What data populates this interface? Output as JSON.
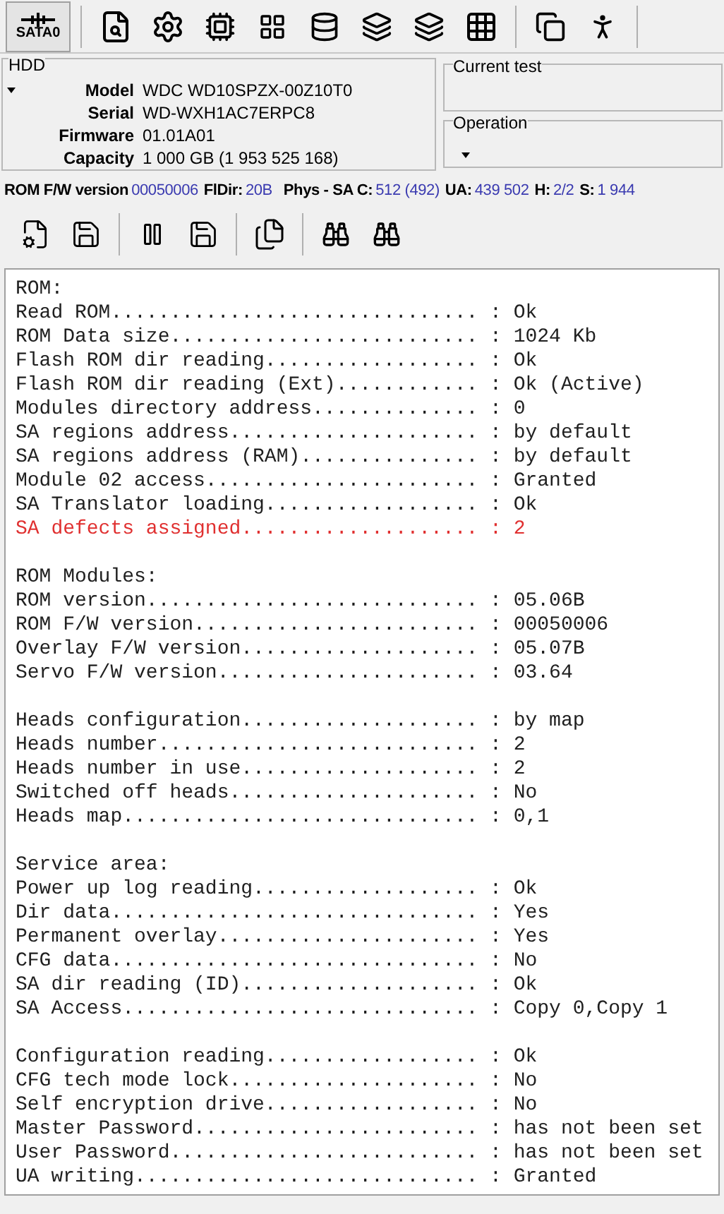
{
  "toolbar": {
    "port_button": {
      "label": "SATA0",
      "selected": true
    }
  },
  "hdd": {
    "title": "HDD",
    "fields": [
      {
        "label": "Model",
        "value": "WDC WD10SPZX-00Z10T0"
      },
      {
        "label": "Serial",
        "value": "WD-WXH1AC7ERPC8"
      },
      {
        "label": "Firmware",
        "value": "01.01A01"
      },
      {
        "label": "Capacity",
        "value": "1 000 GB (1 953 525 168)"
      }
    ]
  },
  "current_test": {
    "title": "Current test"
  },
  "operation": {
    "title": "Operation"
  },
  "info_bar": [
    {
      "label": "ROM F/W version",
      "value": "00050006"
    },
    {
      "label": "FlDir:",
      "value": "20B"
    },
    {
      "label": "Phys - SA C:",
      "value": "512 (492)"
    },
    {
      "label": "UA:",
      "value": "439 502"
    },
    {
      "label": "H:",
      "value": "2/2"
    },
    {
      "label": "S:",
      "value": "1 944"
    }
  ],
  "log": [
    {
      "kind": "line",
      "text": "ROM:",
      "alert": false
    },
    {
      "kind": "line",
      "text": "Read ROM............................... : Ok",
      "alert": false
    },
    {
      "kind": "line",
      "text": "ROM Data size.......................... : 1024 Kb",
      "alert": false
    },
    {
      "kind": "line",
      "text": "Flash ROM dir reading.................. : Ok",
      "alert": false
    },
    {
      "kind": "line",
      "text": "Flash ROM dir reading (Ext)............ : Ok (Active)",
      "alert": false
    },
    {
      "kind": "line",
      "text": "Modules directory address.............. : 0",
      "alert": false
    },
    {
      "kind": "line",
      "text": "SA regions address..................... : by default",
      "alert": false
    },
    {
      "kind": "line",
      "text": "SA regions address (RAM)............... : by default",
      "alert": false
    },
    {
      "kind": "line",
      "text": "Module 02 access....................... : Granted",
      "alert": false
    },
    {
      "kind": "line",
      "text": "SA Translator loading.................. : Ok",
      "alert": false
    },
    {
      "kind": "line",
      "text": "SA defects assigned.................... : 2",
      "alert": true
    },
    {
      "kind": "blank"
    },
    {
      "kind": "line",
      "text": "ROM Modules:",
      "alert": false
    },
    {
      "kind": "line",
      "text": "ROM version............................ : 05.06B",
      "alert": false
    },
    {
      "kind": "line",
      "text": "ROM F/W version........................ : 00050006",
      "alert": false
    },
    {
      "kind": "line",
      "text": "Overlay F/W version.................... : 05.07B",
      "alert": false
    },
    {
      "kind": "line",
      "text": "Servo F/W version...................... : 03.64",
      "alert": false
    },
    {
      "kind": "blank"
    },
    {
      "kind": "line",
      "text": "Heads configuration.................... : by map",
      "alert": false
    },
    {
      "kind": "line",
      "text": "Heads number........................... : 2",
      "alert": false
    },
    {
      "kind": "line",
      "text": "Heads number in use.................... : 2",
      "alert": false
    },
    {
      "kind": "line",
      "text": "Switched off heads..................... : No",
      "alert": false
    },
    {
      "kind": "line",
      "text": "Heads map.............................. : 0,1",
      "alert": false
    },
    {
      "kind": "blank"
    },
    {
      "kind": "line",
      "text": "Service area:",
      "alert": false
    },
    {
      "kind": "line",
      "text": "Power up log reading................... : Ok",
      "alert": false
    },
    {
      "kind": "line",
      "text": "Dir data............................... : Yes",
      "alert": false
    },
    {
      "kind": "line",
      "text": "Permanent overlay...................... : Yes",
      "alert": false
    },
    {
      "kind": "line",
      "text": "CFG data............................... : No",
      "alert": false
    },
    {
      "kind": "line",
      "text": "SA dir reading (ID).................... : Ok",
      "alert": false
    },
    {
      "kind": "line",
      "text": "SA Access.............................. : Copy 0,Copy 1",
      "alert": false
    },
    {
      "kind": "blank"
    },
    {
      "kind": "line",
      "text": "Configuration reading.................. : Ok",
      "alert": false
    },
    {
      "kind": "line",
      "text": "CFG tech mode lock..................... : No",
      "alert": false
    },
    {
      "kind": "line",
      "text": "Self encryption drive.................. : No",
      "alert": false
    },
    {
      "kind": "line",
      "text": "Master Password........................ : has not been set",
      "alert": false
    },
    {
      "kind": "line",
      "text": "User Password.......................... : has not been set",
      "alert": false
    },
    {
      "kind": "line",
      "text": "UA writing............................. : Granted",
      "alert": false
    }
  ]
}
